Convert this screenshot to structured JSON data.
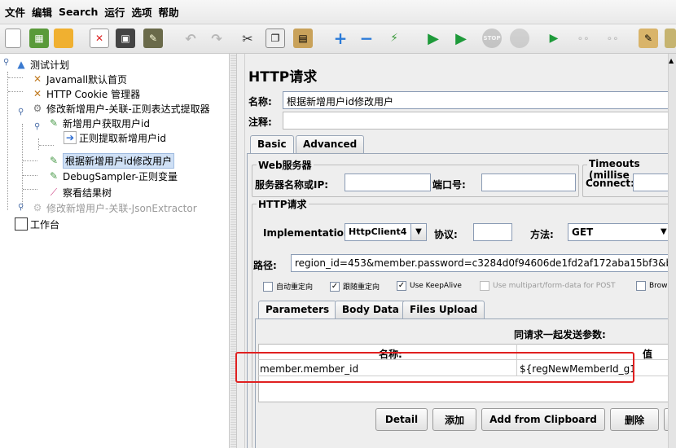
{
  "menu": [
    "文件",
    "编辑",
    "Search",
    "运行",
    "选项",
    "帮助"
  ],
  "toolbar": {
    "icons": [
      "new-icon",
      "templates-icon",
      "open-icon",
      "close-icon",
      "save-icon",
      "save-screenshot-icon",
      "undo-icon",
      "redo-icon",
      "cut-icon",
      "copy-icon",
      "paste-icon",
      "expand-icon",
      "collapse-icon",
      "toggle-icon",
      "start-icon",
      "start-no-pause-icon",
      "stop-icon",
      "shutdown-icon",
      "remote-start-icon",
      "remote-stop-icon",
      "remote-shutdown-icon",
      "clear-icon",
      "clear-all-icon"
    ]
  },
  "tree": {
    "items": [
      {
        "label": "测试计划",
        "icon": "test-plan-icon"
      },
      {
        "label": "Javamall默认首页",
        "icon": "config-element-icon"
      },
      {
        "label": "HTTP Cookie 管理器",
        "icon": "config-element-icon"
      },
      {
        "label": "修改新增用户-关联-正则表达式提取器",
        "icon": "thread-group-icon"
      },
      {
        "label": "新增用户获取用户id",
        "icon": "sampler-icon"
      },
      {
        "label": "正则提取新增用户id",
        "icon": "post-processor-icon"
      },
      {
        "label": "根据新增用户id修改用户",
        "icon": "sampler-icon"
      },
      {
        "label": "DebugSampler-正则变量",
        "icon": "sampler-icon"
      },
      {
        "label": "察看结果树",
        "icon": "listener-icon"
      },
      {
        "label": "修改新增用户-关联-JsonExtractor",
        "icon": "thread-group-icon"
      },
      {
        "label": "工作台",
        "icon": "workbench-icon"
      }
    ]
  },
  "panel": {
    "title": "HTTP请求",
    "name_label": "名称:",
    "name_value": "根据新增用户id修改用户",
    "comment_label": "注释:",
    "tabs": [
      "Basic",
      "Advanced"
    ],
    "web_server": {
      "legend": "Web服务器",
      "server_label": "服务器名称或IP:",
      "port_label": "端口号:",
      "timeouts_legend": "Timeouts (millise",
      "connect_label": "Connect:"
    },
    "http_request": {
      "legend": "HTTP请求",
      "implementation_label": "Implementation:",
      "implementation_value": "HttpClient4",
      "protocol_label": "协议:",
      "method_label": "方法:",
      "method_value": "GET",
      "path_label": "路径:",
      "path_value": "region_id=453&member.password=c3284d0f94606de1fd2af172aba15bf3&birthda"
    },
    "checkboxes": [
      {
        "label": "自动重定向",
        "checked": false
      },
      {
        "label": "跟随重定向",
        "checked": true
      },
      {
        "label": "Use KeepAlive",
        "checked": true
      },
      {
        "label": "Use multipart/form-data for POST",
        "checked": false
      },
      {
        "label": "Brow",
        "checked": false
      }
    ],
    "param_tabs": [
      "Parameters",
      "Body Data",
      "Files Upload"
    ],
    "params_header": "同请求一起发送参数:",
    "columns": [
      "名称:",
      "值"
    ],
    "rows": [
      {
        "name": "member.member_id",
        "value": "${regNewMemberId_g1}"
      }
    ],
    "buttons": [
      "Detail",
      "添加",
      "Add from Clipboard",
      "删除"
    ],
    "highlight_color": "#e02020"
  }
}
